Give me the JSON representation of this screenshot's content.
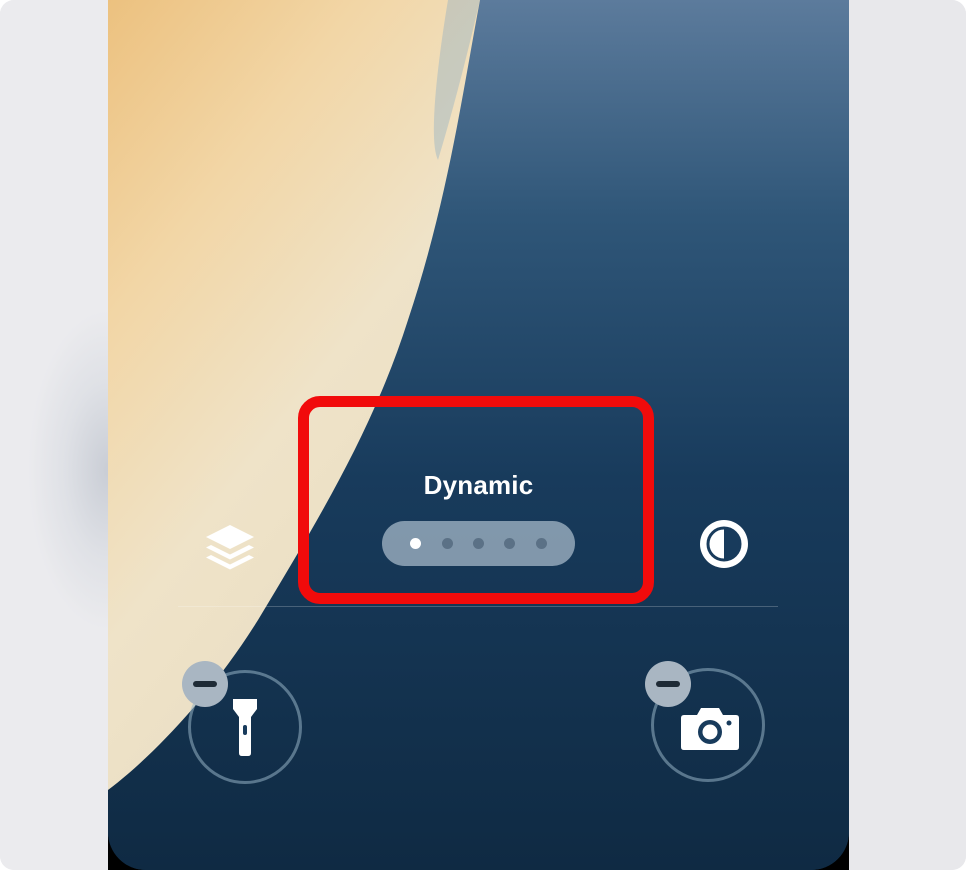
{
  "lock_screen": {
    "wallpaper_style_label": "Dynamic",
    "pager": {
      "total_pages": 5,
      "current_page": 1
    },
    "left_control_icon": "layers-icon",
    "right_control_icon": "contrast-icon",
    "quick_actions": [
      {
        "name": "flashlight",
        "icon": "flashlight-icon",
        "has_remove_badge": true
      },
      {
        "name": "camera",
        "icon": "camera-icon",
        "has_remove_badge": true
      }
    ]
  },
  "colors": {
    "wallpaper_dark_blue": "#173a5b",
    "wallpaper_light_cream": "#efe3c8",
    "wallpaper_peach": "#eec27e",
    "highlight_red": "#f10b0b",
    "badge_gray": "#a9b6c2"
  },
  "annotation": {
    "type": "highlight-box",
    "target": "wallpaper-style-selector"
  }
}
